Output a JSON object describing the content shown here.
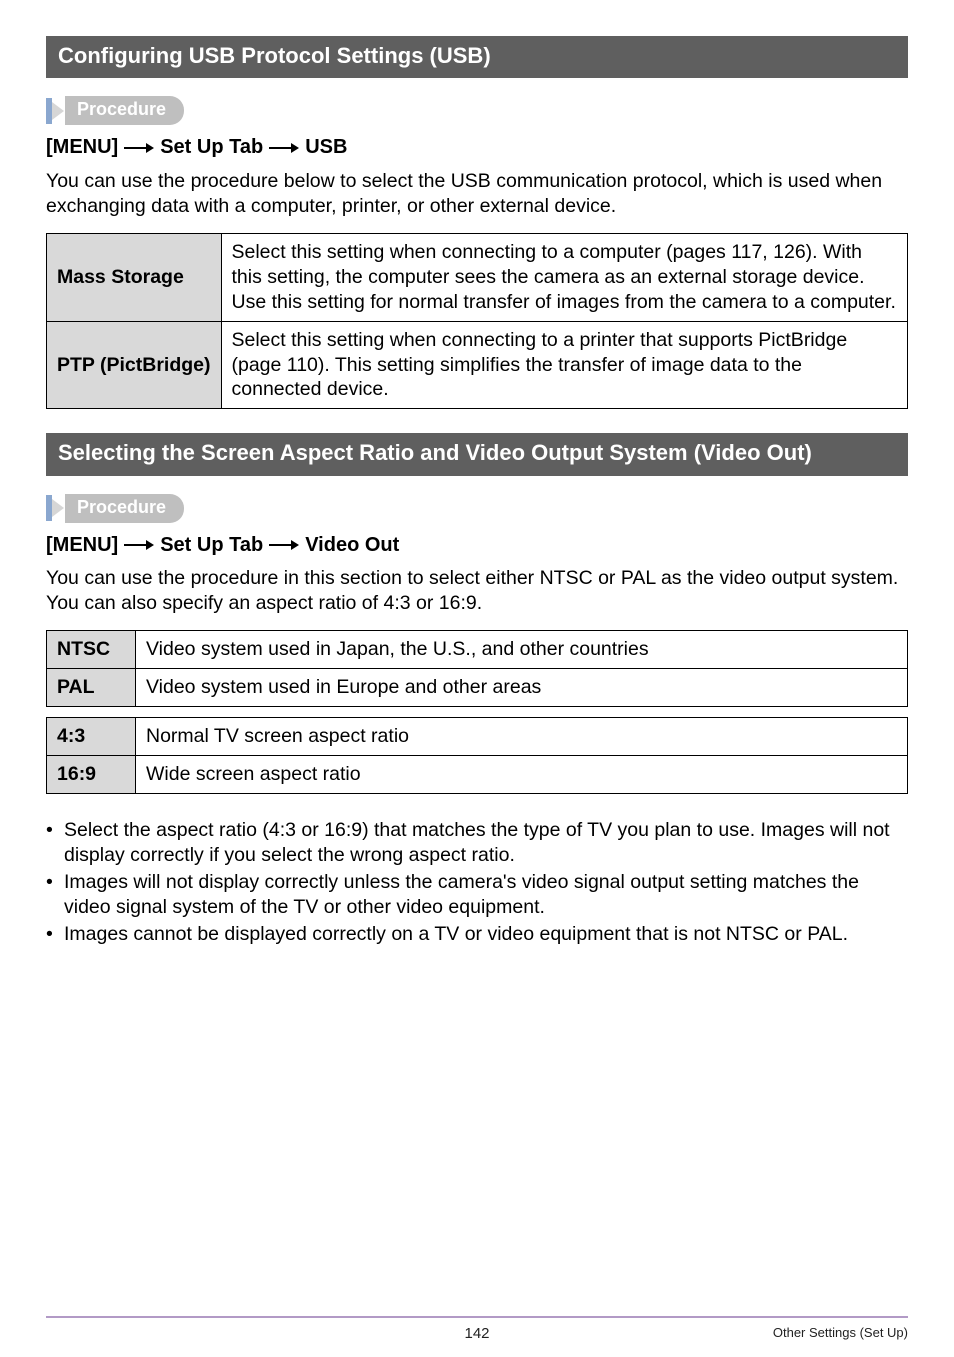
{
  "sections": {
    "usb": {
      "title": "Configuring USB Protocol Settings (USB)",
      "procedure_label": "Procedure",
      "path_parts": [
        "[MENU]",
        "Set Up Tab",
        "USB"
      ],
      "intro": "You can use the procedure below to select the USB communication protocol, which is used when exchanging data with a computer, printer, or other external device.",
      "rows": [
        {
          "head": "Mass Storage",
          "text": "Select this setting when connecting to a computer (pages 117, 126). With this setting, the computer sees the camera as an external storage device. Use this setting for normal transfer of images from the camera to a computer."
        },
        {
          "head": "PTP (PictBridge)",
          "text": "Select this setting when connecting to a printer that supports PictBridge (page 110). This setting simplifies the transfer of image data to the connected device."
        }
      ]
    },
    "video": {
      "title": "Selecting the Screen Aspect Ratio and Video Output System (Video Out)",
      "procedure_label": "Procedure",
      "path_parts": [
        "[MENU]",
        "Set Up Tab",
        "Video Out"
      ],
      "intro": "You can use the procedure in this section to select either NTSC or PAL as the video output system. You can also specify an aspect ratio of 4:3 or 16:9.",
      "sys_rows": [
        {
          "head": "NTSC",
          "text": "Video system used in Japan, the U.S., and other countries"
        },
        {
          "head": "PAL",
          "text": "Video system used in Europe and other areas"
        }
      ],
      "ratio_rows": [
        {
          "head": "4:3",
          "text": "Normal TV screen aspect ratio"
        },
        {
          "head": "16:9",
          "text": "Wide screen aspect ratio"
        }
      ],
      "bullets": [
        "Select the aspect ratio (4:3 or 16:9) that matches the type of TV you plan to use. Images will not display correctly if you select the wrong aspect ratio.",
        "Images will not display correctly unless the camera's video signal output setting matches the video signal system of the TV or other video equipment.",
        "Images cannot be displayed correctly on a TV or video equipment that is not NTSC or PAL."
      ]
    }
  },
  "footer": {
    "page_number": "142",
    "chapter": "Other Settings (Set Up)"
  }
}
